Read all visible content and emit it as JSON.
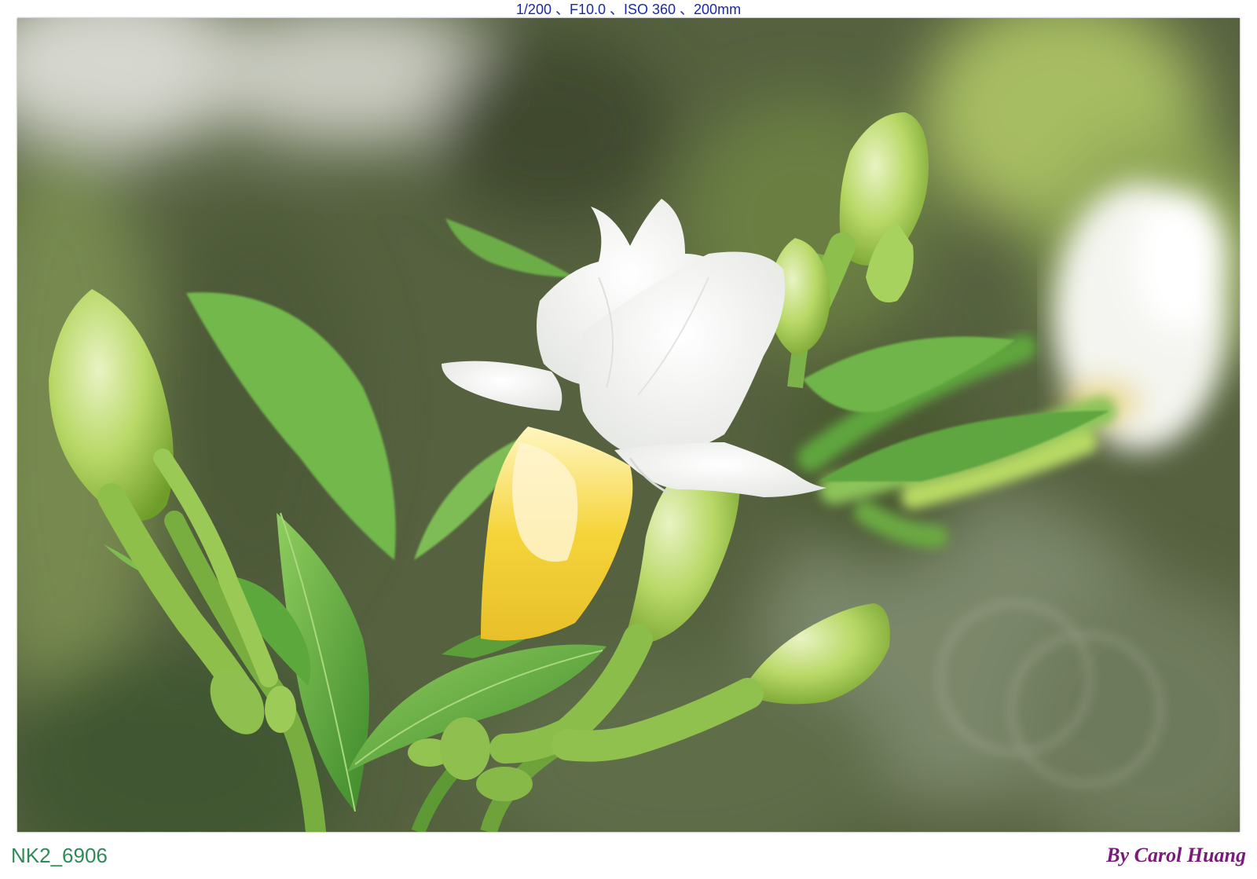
{
  "exif_caption": "1/200 、F10.0 、ISO 360 、200mm",
  "file_id": "NK2_6906",
  "credit": "By Carol Huang",
  "photo": {
    "subject": "white-gardenia-flower",
    "colors": {
      "background": "#5b6a46",
      "leaf": "#6fb64a",
      "bud": "#b7d964",
      "petal": "#fbfbf8",
      "throat": "#f3d23a"
    }
  }
}
